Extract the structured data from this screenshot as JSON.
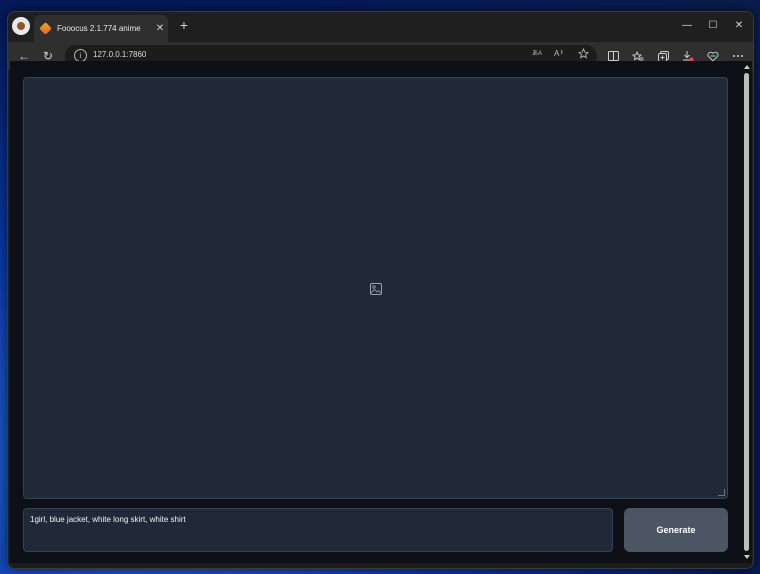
{
  "browser": {
    "tab_title": "Fooocus 2.1.774 anime",
    "tab_close": "✕",
    "new_tab": "+",
    "url": "127.0.0.1:7860",
    "controls": {
      "minimize": "—",
      "maximize": "☐",
      "close": "✕"
    },
    "nav": {
      "back": "←",
      "refresh": "↻"
    },
    "toolbar_icons": [
      "translate-icon",
      "read-aloud-icon",
      "favorite-star-icon",
      "split-screen-icon",
      "favorites-icon",
      "collections-icon",
      "downloads-icon",
      "copilot-icon",
      "more-icon"
    ]
  },
  "app": {
    "prompt_value": "1girl, blue jacket, white long skirt, white shirt",
    "generate_label": "Generate"
  },
  "colors": {
    "panel_bg": "#1f2937",
    "button_bg": "#4b5563",
    "page_bg": "#0d1117"
  }
}
